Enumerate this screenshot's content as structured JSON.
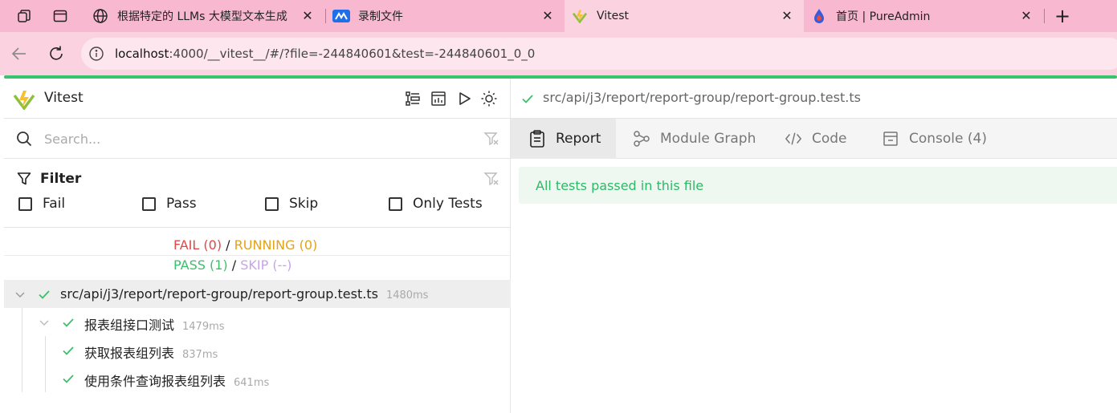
{
  "browser": {
    "tabs": [
      {
        "title": "根据特定的 LLMs 大模型文本生成",
        "icon": "globe-icon",
        "close": "✕"
      },
      {
        "title": "录制文件",
        "icon": "recorder-icon",
        "close": "✕"
      },
      {
        "title": "Vitest",
        "icon": "vitest-icon",
        "close": "✕"
      },
      {
        "title": "首页 | PureAdmin",
        "icon": "pureadmin-icon",
        "close": "✕"
      }
    ],
    "new_tab": "+",
    "url_host": "localhost",
    "url_rest": ":4000/__vitest__/#/?file=-244840601&test=-244840601_0_0"
  },
  "app": {
    "title": "Vitest",
    "search": {
      "placeholder": "Search..."
    },
    "filter": {
      "title": "Filter",
      "options": [
        "Fail",
        "Pass",
        "Skip",
        "Only Tests"
      ]
    },
    "summary": {
      "fail": "FAIL (0)",
      "running": "RUNNING (0)",
      "pass": "PASS (1)",
      "skip": "SKIP (--)",
      "sep": "/"
    },
    "tree": [
      {
        "label": "src/api/j3/report/report-group/report-group.test.ts",
        "duration": "1480ms"
      },
      {
        "label": "报表组接口测试",
        "duration": "1479ms"
      },
      {
        "label": "获取报表组列表",
        "duration": "837ms"
      },
      {
        "label": "使用条件查询报表组列表",
        "duration": "641ms"
      }
    ],
    "detail": {
      "path": "src/api/j3/report/report-group/report-group.test.ts",
      "tabs": [
        "Report",
        "Module Graph",
        "Code",
        "Console (4)"
      ],
      "banner": "All tests passed in this file"
    }
  },
  "colors": {
    "accent": "#37c46d",
    "fail": "#e04848",
    "running": "#e3a21a",
    "pass": "#3cbf6a",
    "skip": "#c7a3ea",
    "tabstrip": "#f8b8cf"
  }
}
